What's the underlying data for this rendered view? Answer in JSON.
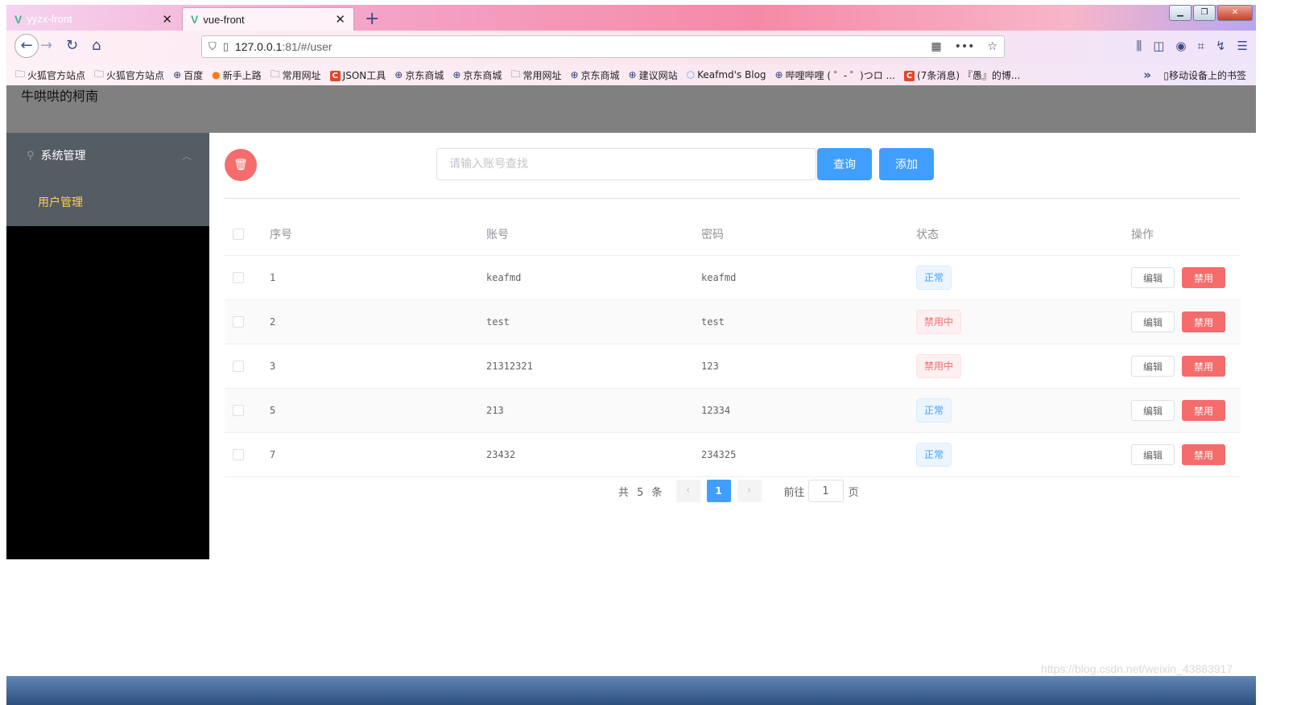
{
  "browser": {
    "tabs": [
      {
        "title": "yyzx-front",
        "active": false
      },
      {
        "title": "vue-front",
        "active": true
      }
    ],
    "url_host": "127.0.0.1",
    "url_path": ":81/#/user",
    "bookmarks": [
      {
        "label": "火狐官方站点",
        "icon": "folder-icon"
      },
      {
        "label": "火狐官方站点",
        "icon": "folder-icon"
      },
      {
        "label": "百度",
        "icon": "globe-icon"
      },
      {
        "label": "新手上路",
        "icon": "firefox-icon"
      },
      {
        "label": "常用网址",
        "icon": "folder-icon"
      },
      {
        "label": "JSON工具",
        "icon": "csdn-icon"
      },
      {
        "label": "京东商城",
        "icon": "globe-icon"
      },
      {
        "label": "京东商城",
        "icon": "globe-icon"
      },
      {
        "label": "常用网址",
        "icon": "folder-icon"
      },
      {
        "label": "京东商城",
        "icon": "globe-icon"
      },
      {
        "label": "建议网站",
        "icon": "globe-icon"
      },
      {
        "label": "Keafmd's Blog",
        "icon": "blog-icon"
      },
      {
        "label": "哔哩哔哩 ( ゜- ゜)つロ ...",
        "icon": "globe-icon"
      },
      {
        "label": "(7条消息) 『愚』的博...",
        "icon": "csdn-icon"
      }
    ],
    "mobile_bookmarks": "移动设备上的书签"
  },
  "app": {
    "brand": "牛哄哄的柯南",
    "sidebar": {
      "group_label": "系统管理",
      "item_label": "用户管理"
    },
    "toolbar": {
      "search_placeholder": "请输入账号查找",
      "search_value": "",
      "query_label": "查询",
      "add_label": "添加"
    },
    "table": {
      "headers": {
        "index": "序号",
        "account": "账号",
        "password": "密码",
        "status": "状态",
        "actions": "操作"
      },
      "rows": [
        {
          "index": "1",
          "account": "keafmd",
          "password": "keafmd",
          "status": "正常",
          "status_type": "ok"
        },
        {
          "index": "2",
          "account": "test",
          "password": "test",
          "status": "禁用中",
          "status_type": "ban"
        },
        {
          "index": "3",
          "account": "21312321",
          "password": "123",
          "status": "禁用中",
          "status_type": "ban"
        },
        {
          "index": "5",
          "account": "213",
          "password": "12334",
          "status": "正常",
          "status_type": "ok"
        },
        {
          "index": "7",
          "account": "23432",
          "password": "234325",
          "status": "正常",
          "status_type": "ok"
        }
      ],
      "edit_label": "编辑",
      "ban_label": "禁用"
    },
    "pagination": {
      "total": "共 5 条",
      "current_page": "1",
      "goto_label": "前往",
      "goto_value": "1",
      "page_suffix": "页"
    }
  },
  "watermark": "https://blog.csdn.net/weixin_43883917",
  "colors": {
    "primary": "#409eff",
    "danger": "#f56c6c",
    "menu_bg": "#545c64",
    "menu_active": "#ffd04b",
    "header_bg": "#808080"
  }
}
